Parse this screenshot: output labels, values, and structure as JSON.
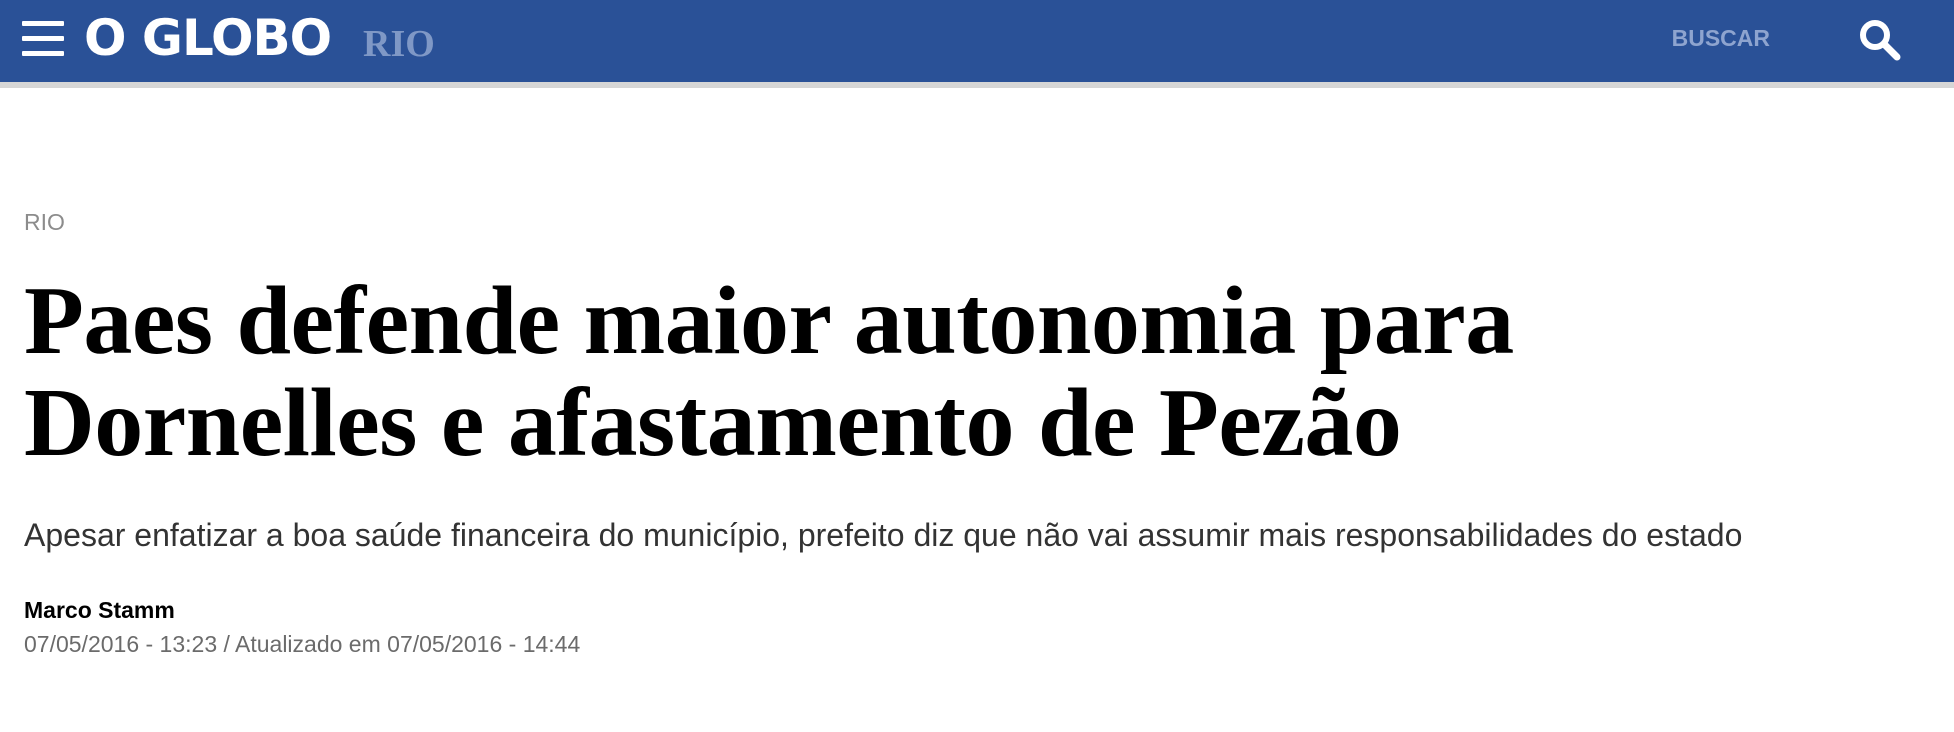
{
  "header": {
    "menu_icon": "hamburger-menu-icon",
    "logo_text": "O GLOBO",
    "section_tag": "RIO",
    "search_label": "BUSCAR",
    "search_icon": "magnifier-icon",
    "bar_color": "#2a5197"
  },
  "article": {
    "kicker": "RIO",
    "headline": "Paes defende maior autonomia para Dornelles e afastamento de Pezão",
    "subtitle": "Apesar enfatizar a boa saúde financeira do município, prefeito diz que não vai assumir mais responsabilidades do estado",
    "author": "Marco Stamm",
    "dateline": "07/05/2016 - 13:23 / Atualizado em 07/05/2016 - 14:44"
  }
}
